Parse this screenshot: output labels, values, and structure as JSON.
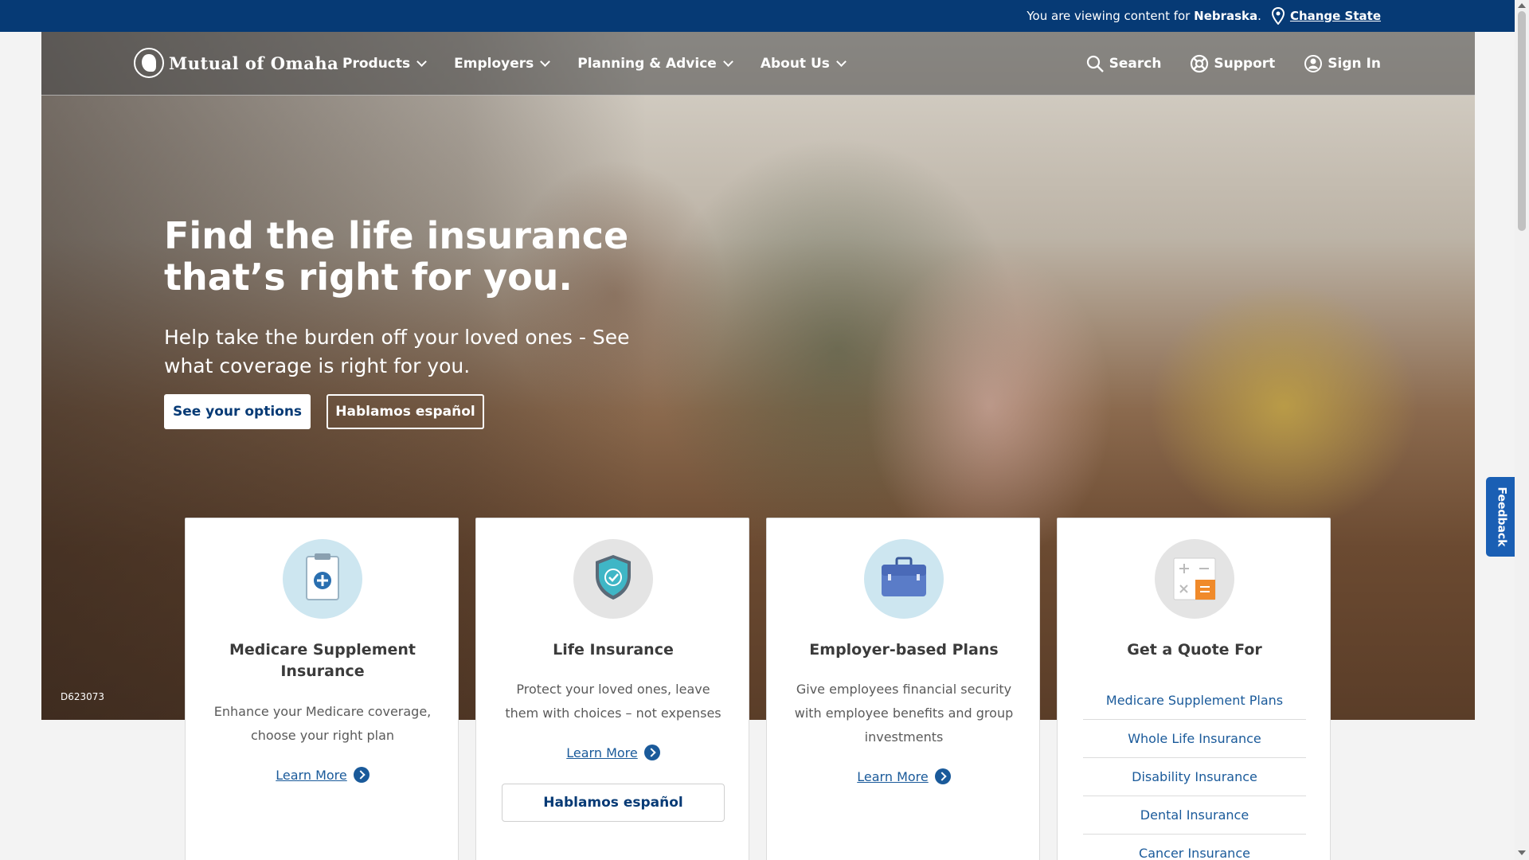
{
  "topbar": {
    "viewing_prefix": "You are viewing content for",
    "state": "Nebraska",
    "state_suffix": ".",
    "change_state": "Change State"
  },
  "nav": {
    "logo": "Mutual of Omaha",
    "menu": [
      "Products",
      "Employers",
      "Planning & Advice",
      "About Us"
    ],
    "search": "Search",
    "support": "Support",
    "sign_in": "Sign In"
  },
  "hero": {
    "title": "Find the life insurance that’s right for you.",
    "subtitle": "Help take the burden off your loved ones - See what coverage is right for you.",
    "primary_button": "See your options",
    "secondary_button": "Hablamos español",
    "photo_id": "D623073"
  },
  "cards": [
    {
      "title": "Medicare Supplement Insurance",
      "description": "Enhance your Medicare coverage, choose your right plan",
      "link": "Learn More",
      "icon": "clipboard-plus-icon"
    },
    {
      "title": "Life Insurance",
      "description": "Protect your loved ones, leave them with choices – not expenses",
      "link": "Learn More",
      "button": "Hablamos español",
      "icon": "shield-check-icon"
    },
    {
      "title": "Employer-based Plans",
      "description": "Give employees financial security with employee benefits and group investments",
      "link": "Learn More",
      "icon": "briefcase-icon"
    },
    {
      "title": "Get a Quote For",
      "icon": "calculator-icon",
      "links": [
        "Medicare Supplement Plans",
        "Whole Life Insurance",
        "Disability Insurance",
        "Dental Insurance",
        "Cancer Insurance"
      ]
    }
  ],
  "feedback": "Feedback",
  "colors": {
    "brand_navy": "#063a75",
    "link_blue": "#1a5a9a",
    "feedback_blue": "#1a5fb4"
  }
}
